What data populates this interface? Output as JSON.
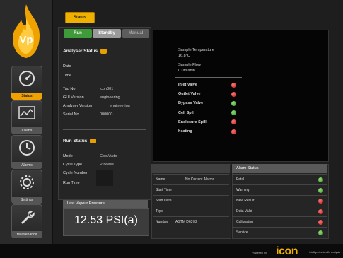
{
  "app": {
    "logo_text": "Vp"
  },
  "nav": [
    {
      "label": "Status",
      "icon": "gauge-icon",
      "active": true
    },
    {
      "label": "Charts",
      "icon": "chart-icon",
      "active": false
    },
    {
      "label": "Alarms",
      "icon": "clock-icon",
      "active": false
    },
    {
      "label": "Settings",
      "icon": "settings-icon",
      "active": false
    },
    {
      "label": "Maintenance",
      "icon": "wrench-icon",
      "active": false
    }
  ],
  "top": {
    "status_button": "Status"
  },
  "modes": {
    "run": "Run",
    "standby": "Standby",
    "manual": "Manual"
  },
  "analyser": {
    "title": "Analyser Status",
    "date_label": "Date",
    "time_label": "Time",
    "tag_label": "Tag No",
    "tag_value": "icon001",
    "gui_label": "GUI Version",
    "gui_value": "engineering",
    "av_label": "Analyser Version",
    "av_value": "engineering",
    "serial_label": "Serial No",
    "serial_value": "000000"
  },
  "run_status": {
    "title": "Run Status",
    "mode_label": "Mode",
    "mode_value": "Cool/Auto",
    "cycle_type_label": "Cycle Type",
    "cycle_type_value": "Process",
    "cycle_number_label": "Cycle Number",
    "run_time_label": "Run Time"
  },
  "pressure": {
    "title": "Last Vapour Pressure",
    "value": "12.53 PSI(a)"
  },
  "sample": {
    "temp_label": "Sample Temperature",
    "temp_value": "16.8°C",
    "flow_label": "Sample Flow",
    "flow_value": "0.0ml/min"
  },
  "valves": [
    {
      "label": "Inlet Valve",
      "state": "red"
    },
    {
      "label": "Outlet Valve",
      "state": "red"
    },
    {
      "label": "Bypass Valve",
      "state": "green"
    },
    {
      "label": "Cell Spill",
      "state": "green"
    },
    {
      "label": "Enclosure Spill",
      "state": "red"
    },
    {
      "label": "heating",
      "state": "red"
    }
  ],
  "method": {
    "name_label": "Name",
    "name_value": "No Current Alarms",
    "start_time_label": "Start Time",
    "start_date_label": "Start Date",
    "type_label": "Type",
    "number_label": "Number",
    "number_value": "ASTM D6378"
  },
  "alarms": {
    "title": "Alarm Status",
    "items": [
      {
        "label": "Fatal",
        "state": "green"
      },
      {
        "label": "Warning",
        "state": "green"
      },
      {
        "label": "New Result",
        "state": "red"
      },
      {
        "label": "Data Valid",
        "state": "red"
      },
      {
        "label": "Calibrating",
        "state": "red"
      },
      {
        "label": "Service",
        "state": "green"
      }
    ]
  },
  "footer": {
    "powered": "Powered by",
    "brand": "icon",
    "tagline": "intelligent scientific analysis"
  },
  "colors": {
    "accent": "#f0b000",
    "ok": "#2e8b20",
    "fault": "#c01818",
    "run": "#4caf50"
  }
}
